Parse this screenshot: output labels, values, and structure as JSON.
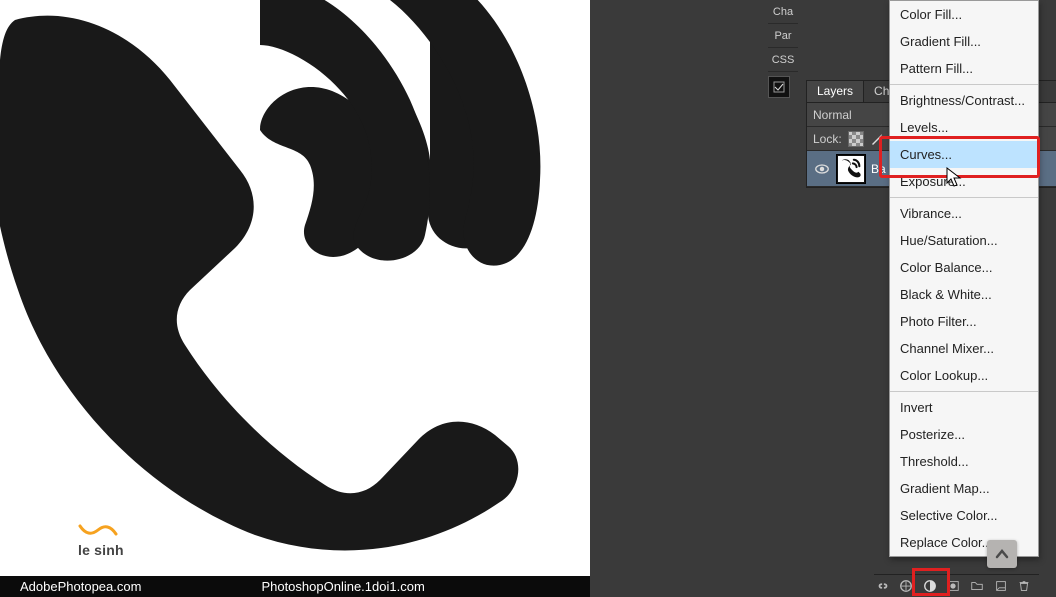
{
  "canvas": {
    "watermark_text": "le sinh"
  },
  "footer": {
    "url_left": "AdobePhotopea.com",
    "url_right": "PhotoshopOnline.1doi1.com"
  },
  "side_tabs": {
    "t0": "Cha",
    "t1": "Par",
    "t2": "CSS"
  },
  "layers_panel": {
    "tabs": {
      "layers": "Layers",
      "channels": "Chan"
    },
    "blend_mode": "Normal",
    "lock_label": "Lock:",
    "layer0_name": "Ba"
  },
  "ctx": {
    "items": [
      "Color Fill...",
      "Gradient Fill...",
      "Pattern Fill...",
      "Brightness/Contrast...",
      "Levels...",
      "Curves...",
      "Exposure...",
      "Vibrance...",
      "Hue/Saturation...",
      "Color Balance...",
      "Black & White...",
      "Photo Filter...",
      "Channel Mixer...",
      "Color Lookup...",
      "Invert",
      "Posterize...",
      "Threshold...",
      "Gradient Map...",
      "Selective Color...",
      "Replace Color..."
    ],
    "highlight_index": 5,
    "separators_after": [
      2,
      6,
      13
    ]
  }
}
